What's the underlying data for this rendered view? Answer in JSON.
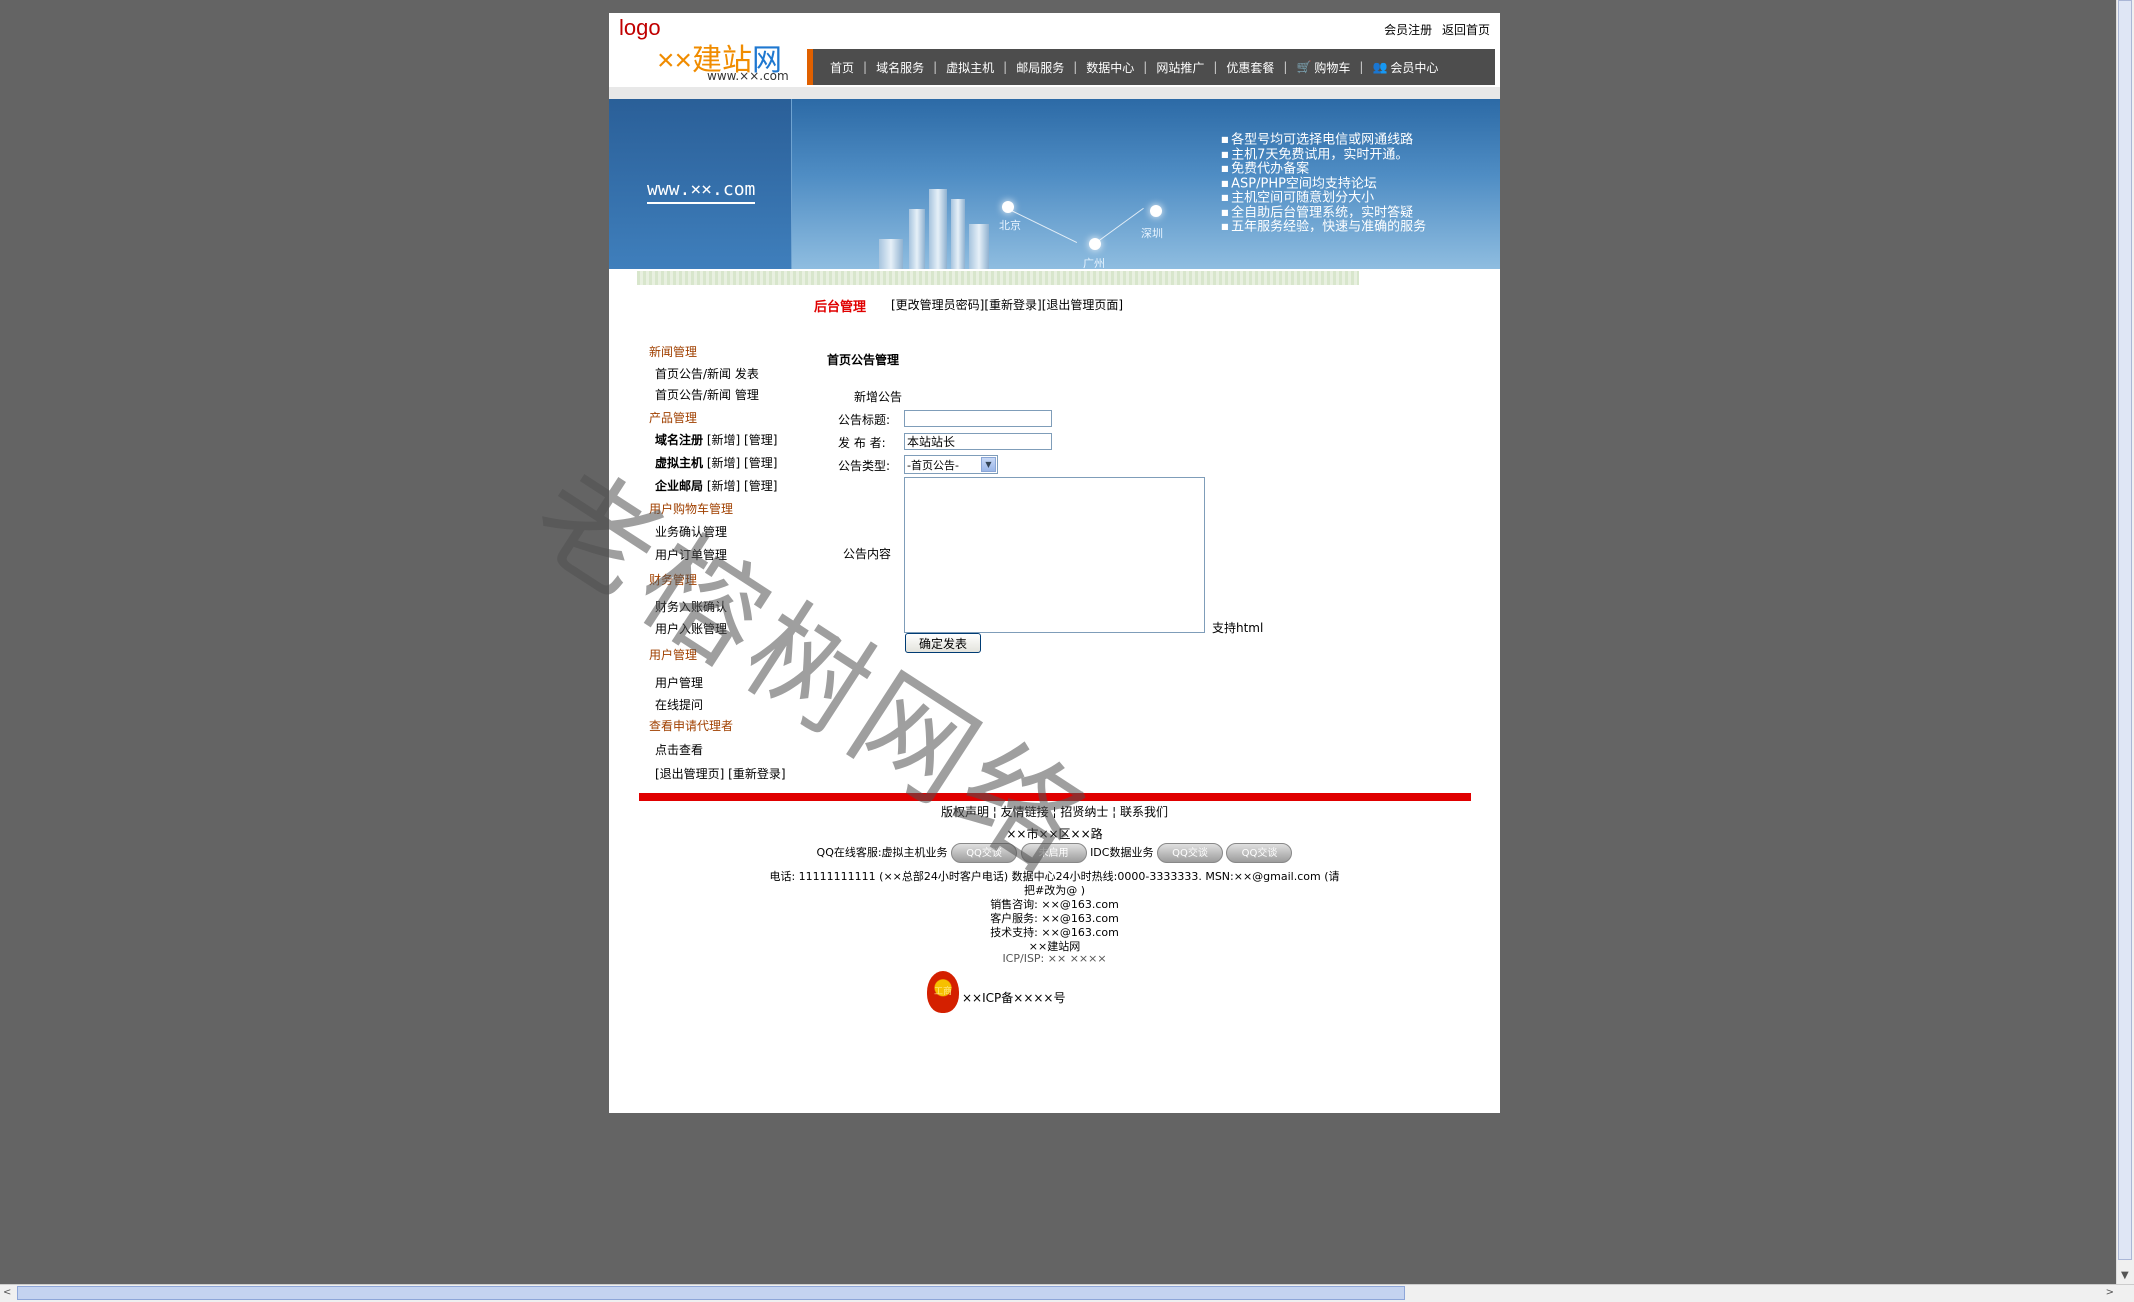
{
  "header": {
    "logo": "logo",
    "brand_prefix": "××",
    "brand_main": "建站",
    "brand_suffix": "网",
    "domain": "www.××.com",
    "top_links": [
      "会员注册",
      "返回首页"
    ]
  },
  "nav": {
    "items": [
      "首页",
      "域名服务",
      "虚拟主机",
      "邮局服务",
      "数据中心",
      "网站推广",
      "优惠套餐",
      "购物车",
      "会员中心"
    ]
  },
  "banner": {
    "url": "www.××.com",
    "features": [
      "各型号均可选择电信或网通线路",
      "主机7天免费试用，实时开通。",
      "免费代办备案",
      "ASP/PHP空间均支持论坛",
      "主机空间可随意划分大小",
      "全自助后台管理系统，实时答疑",
      "五年服务经验，快速与准确的服务"
    ],
    "cities": [
      "北京",
      "深圳",
      "广州"
    ]
  },
  "admin": {
    "title": "后台管理",
    "links": [
      "[更改管理员密码]",
      "[重新登录]",
      "[退出管理页面]"
    ]
  },
  "sidebar": {
    "cat_news": "新闻管理",
    "news_publish": "首页公告/新闻 发表",
    "news_manage": "首页公告/新闻 管理",
    "cat_product": "产品管理",
    "domain_label": "域名注册",
    "host_label": "虚拟主机",
    "mail_label": "企业邮局",
    "add": "[新增]",
    "manage": "[管理]",
    "cat_cart": "用户购物车管理",
    "cart_confirm": "业务确认管理",
    "cart_orders": "用户订单管理",
    "cat_finance": "财务管理",
    "finance_confirm": "财务入账确认",
    "finance_user": "用户入账管理",
    "cat_user": "用户管理",
    "user_manage": "用户管理",
    "user_ask": "在线提问",
    "cat_agent": "查看申请代理者",
    "agent_view": "点击查看",
    "logout_links": "[退出管理页] [重新登录]"
  },
  "form": {
    "heading": "首页公告管理",
    "subheading": "新增公告",
    "title_label": "公告标题:",
    "title_value": "",
    "author_label": "发 布 者:",
    "author_value": "本站站长",
    "type_label": "公告类型:",
    "type_value": "-首页公告-",
    "content_label": "公告内容",
    "html_note": "支持html",
    "submit": "确定发表"
  },
  "footer": {
    "links": [
      "版权声明",
      "友情链接",
      "招贤纳士",
      "联系我们"
    ],
    "address": "××市××区××路",
    "qq_label": "QQ在线客服:虚拟主机业务",
    "qq_btn": "QQ交谈",
    "qq_btn_off": "未启用",
    "idc_label": "IDC数据业务",
    "phone_line": "电话: 11111111111 (××总部24小时客户电话) 数据中心24小时热线:0000-3333333. MSN:××@gmail.com (请",
    "phone_line2": "把#改为@ )",
    "sales": "销售咨询: ××@163.com",
    "service": "客户服务: ××@163.com",
    "support": "技术支持: ××@163.com",
    "site": "××建站网",
    "icp": "ICP/ISP: ×× ××××",
    "icp_no": "××ICP备××××号",
    "badge_text": "工商"
  },
  "watermark": "老榕树网络"
}
